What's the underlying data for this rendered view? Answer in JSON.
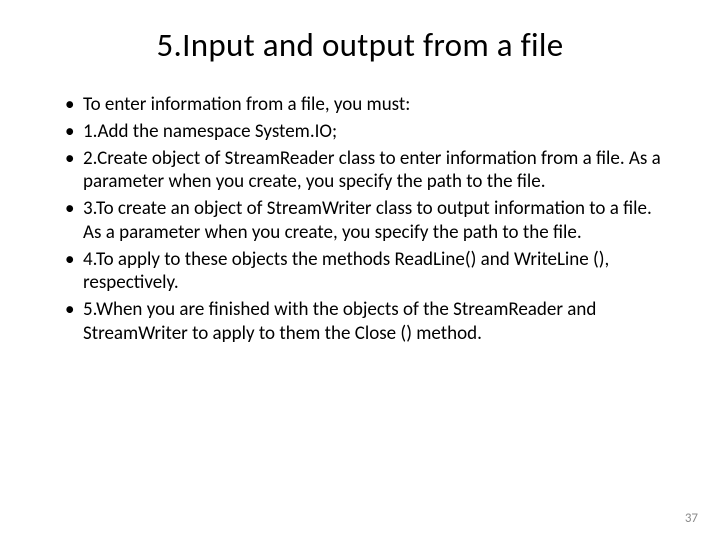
{
  "title": "5.Input and output from a file",
  "bullets": [
    "To enter information from a file, you must:",
    " 1.Add the namespace System.IO;",
    " 2.Create object of StreamReader class to enter information from a file. As a parameter when you create, you specify the path to the file.",
    " 3.To create an object of StreamWriter class to output information to a file. As a parameter when you create, you specify the path to the file.",
    " 4.To apply to these objects the methods ReadLine() and WriteLine (), respectively.",
    " 5.When you are finished with the objects of the StreamReader and StreamWriter to apply   to them the Close () method."
  ],
  "page_number": "37"
}
